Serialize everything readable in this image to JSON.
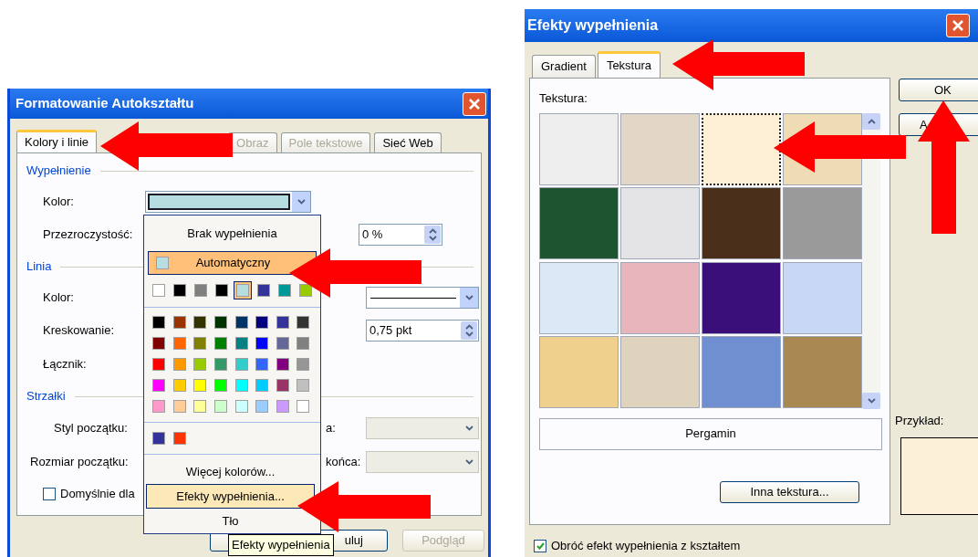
{
  "format_dialog": {
    "title": "Formatowanie Autokształtu",
    "tabs": [
      {
        "label": "Kolory i linie",
        "selected": true,
        "disabled": false
      },
      {
        "label": "Obraz",
        "selected": false,
        "disabled": true
      },
      {
        "label": "Pole tekstowe",
        "selected": false,
        "disabled": true
      },
      {
        "label": "Sieć Web",
        "selected": false,
        "disabled": false
      }
    ],
    "fill_section": {
      "heading": "Wypełnienie",
      "color_label": "Kolor:",
      "transparency_label": "Przezroczystość:",
      "transparency_value": "0 %"
    },
    "line_section": {
      "heading": "Linia",
      "color_label": "Kolor:",
      "dash_label": "Kreskowanie:",
      "weight_value": "0,75 pkt",
      "connector_label": "Łącznik:"
    },
    "arrows_section": {
      "heading": "Strzałki",
      "begin_style_label": "Styl początku:",
      "end_style_label": "a:",
      "begin_size_label": "Rozmiar początku:",
      "end_size_label": "końca:"
    },
    "default_checkbox": {
      "label": "Domyślnie dla",
      "checked": false
    },
    "buttons": [
      {
        "label": "uluj",
        "disabled": false
      },
      {
        "label": "Podgląd",
        "disabled": true
      }
    ]
  },
  "color_menu": {
    "no_fill": {
      "label": "Brak wypełnienia",
      "selected": false
    },
    "automatic": {
      "label": "Automatyczny",
      "selected": true
    },
    "recent_colors": [
      {
        "color": "#ffffff",
        "selected": false
      },
      {
        "color": "#000000",
        "selected": false
      },
      {
        "color": "#808080",
        "selected": false
      },
      {
        "color": "#000000",
        "selected": false
      },
      {
        "color": "#b7dde0",
        "selected": true
      },
      {
        "color": "#333399",
        "selected": false
      },
      {
        "color": "#009999",
        "selected": false
      },
      {
        "color": "#99cc00",
        "selected": false
      }
    ],
    "palette": [
      {
        "color": "#000000",
        "selected": false
      },
      {
        "color": "#993300",
        "selected": false
      },
      {
        "color": "#333300",
        "selected": false
      },
      {
        "color": "#003300",
        "selected": false
      },
      {
        "color": "#003366",
        "selected": false
      },
      {
        "color": "#000080",
        "selected": false
      },
      {
        "color": "#333399",
        "selected": false
      },
      {
        "color": "#333333",
        "selected": false
      },
      {
        "color": "#800000",
        "selected": false
      },
      {
        "color": "#ff6600",
        "selected": false
      },
      {
        "color": "#808000",
        "selected": false
      },
      {
        "color": "#008000",
        "selected": false
      },
      {
        "color": "#008080",
        "selected": false
      },
      {
        "color": "#0000ff",
        "selected": false
      },
      {
        "color": "#666699",
        "selected": false
      },
      {
        "color": "#808080",
        "selected": false
      },
      {
        "color": "#ff0000",
        "selected": false
      },
      {
        "color": "#ff9900",
        "selected": false
      },
      {
        "color": "#99cc00",
        "selected": false
      },
      {
        "color": "#339966",
        "selected": false
      },
      {
        "color": "#33cccc",
        "selected": false
      },
      {
        "color": "#3366ff",
        "selected": false
      },
      {
        "color": "#800080",
        "selected": false
      },
      {
        "color": "#969696",
        "selected": false
      },
      {
        "color": "#ff00ff",
        "selected": false
      },
      {
        "color": "#ffcc00",
        "selected": false
      },
      {
        "color": "#ffff00",
        "selected": false
      },
      {
        "color": "#00ff00",
        "selected": false
      },
      {
        "color": "#00ffff",
        "selected": false
      },
      {
        "color": "#00ccff",
        "selected": false
      },
      {
        "color": "#993366",
        "selected": false
      },
      {
        "color": "#c0c0c0",
        "selected": false
      },
      {
        "color": "#ff99cc",
        "selected": false
      },
      {
        "color": "#ffcc99",
        "selected": false
      },
      {
        "color": "#ffff99",
        "selected": false
      },
      {
        "color": "#ccffcc",
        "selected": false
      },
      {
        "color": "#ccffff",
        "selected": false
      },
      {
        "color": "#99ccff",
        "selected": false
      },
      {
        "color": "#cc99ff",
        "selected": false
      },
      {
        "color": "#ffffff",
        "selected": false
      }
    ],
    "custom_colors": [
      {
        "color": "#333399",
        "selected": false
      },
      {
        "color": "#ff3300",
        "selected": false
      }
    ],
    "commands": [
      {
        "label": "Więcej kolorów...",
        "hovered": false
      },
      {
        "label": "Efekty wypełnienia...",
        "hovered": true
      },
      {
        "label": "Tło",
        "hovered": false
      }
    ]
  },
  "tooltip": "Efekty wypełnienia",
  "fill_dialog": {
    "title": "Efekty wypełnienia",
    "tabs": [
      {
        "label": "Gradient",
        "selected": false
      },
      {
        "label": "Tekstura",
        "selected": true
      }
    ],
    "texture_label": "Tekstura:",
    "textures": [
      {
        "color": "#eeeeee",
        "selected": false
      },
      {
        "color": "#e2d6c6",
        "selected": false
      },
      {
        "color": "#fcefd6",
        "selected": true
      },
      {
        "color": "#efdcb4",
        "selected": false
      },
      {
        "color": "#1e5530",
        "selected": false
      },
      {
        "color": "#e4e4e6",
        "selected": false
      },
      {
        "color": "#4a2f1a",
        "selected": false
      },
      {
        "color": "#9a9a9a",
        "selected": false
      },
      {
        "color": "#dbe8f6",
        "selected": false
      },
      {
        "color": "#e8b5bc",
        "selected": false
      },
      {
        "color": "#3b0f7a",
        "selected": false
      },
      {
        "color": "#c8d8f4",
        "selected": false
      },
      {
        "color": "#efd08d",
        "selected": false
      },
      {
        "color": "#e0d3bd",
        "selected": false
      },
      {
        "color": "#6f8fd0",
        "selected": false
      },
      {
        "color": "#a98852",
        "selected": false
      }
    ],
    "texture_name": "Pergamin",
    "other_texture_button": "Inna tekstura...",
    "buttons": [
      "OK",
      "A"
    ],
    "preview_label": "Przykład:",
    "rotate_checkbox": {
      "label": "Obróć efekt wypełnienia z kształtem",
      "checked": true
    }
  }
}
